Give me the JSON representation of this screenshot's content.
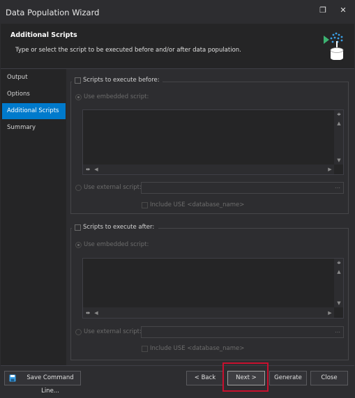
{
  "window": {
    "title": "Data Population Wizard",
    "maximize_glyph": "❐",
    "close_glyph": "✕"
  },
  "header": {
    "title": "Additional Scripts",
    "description": "Type or select the script to be executed before and/or after data population.",
    "icon": "database-script-icon"
  },
  "sidebar": {
    "items": [
      {
        "label": "Output",
        "active": false
      },
      {
        "label": "Options",
        "active": false
      },
      {
        "label": "Additional Scripts",
        "active": true
      },
      {
        "label": "Summary",
        "active": false
      }
    ]
  },
  "before": {
    "group_label": "Scripts to execute before:",
    "embedded_label": "Use embedded script:",
    "external_label": "Use external script:",
    "external_value": "",
    "browse_label": "...",
    "include_use_label": "Include USE <database_name>"
  },
  "after": {
    "group_label": "Scripts to execute after:",
    "embedded_label": "Use embedded script:",
    "external_label": "Use external script:",
    "external_value": "",
    "browse_label": "...",
    "include_use_label": "Include USE <database_name>"
  },
  "footer": {
    "save_command_line": "Save Command Line...",
    "back": "< Back",
    "next": "Next >",
    "generate": "Generate",
    "close": "Close"
  },
  "colors": {
    "accent": "#007acc",
    "highlight": "#c8102e",
    "background": "#2d2d30"
  }
}
